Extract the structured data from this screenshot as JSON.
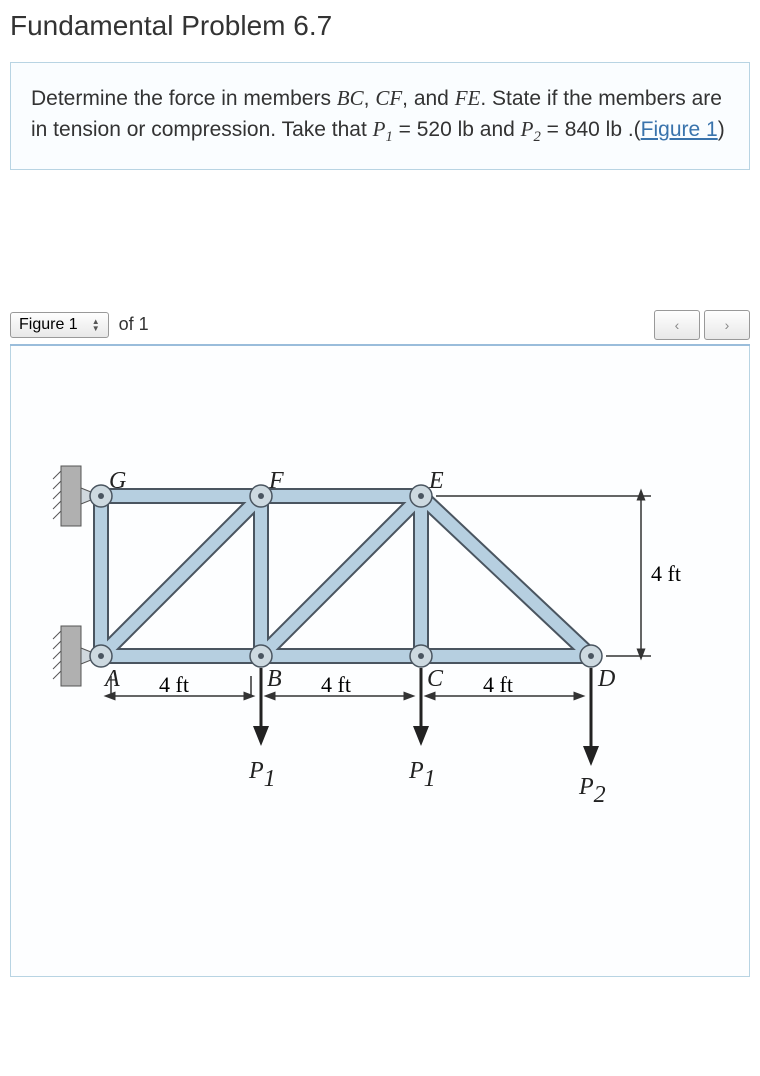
{
  "title": "Fundamental Problem 6.7",
  "problem": {
    "prefix": "Determine the force in members ",
    "m1": "BC",
    "sep1": ", ",
    "m2": "CF",
    "sep2": ", and ",
    "m3": "FE",
    "suffix1": ". State if the members are in tension or compression. Take that ",
    "p1_sym": "P",
    "p1_sub": "1",
    "p1_val": " = 520 lb and ",
    "p2_sym": "P",
    "p2_sub": "2",
    "p2_val": " = 840 lb .(",
    "fig_link": "Figure 1",
    "tail": ")"
  },
  "toolbar": {
    "figure_label": "Figure 1",
    "of_text": "of 1",
    "prev": "‹",
    "next": "›"
  },
  "diagram": {
    "nodes": {
      "A": "A",
      "B": "B",
      "C": "C",
      "D": "D",
      "E": "E",
      "F": "F",
      "G": "G"
    },
    "dims": {
      "span1": "4 ft",
      "span2": "4 ft",
      "span3": "4 ft",
      "height": "4 ft"
    },
    "loads": {
      "P1a": "P",
      "P1a_sub": "1",
      "P1b": "P",
      "P1b_sub": "1",
      "P2": "P",
      "P2_sub": "2"
    }
  }
}
